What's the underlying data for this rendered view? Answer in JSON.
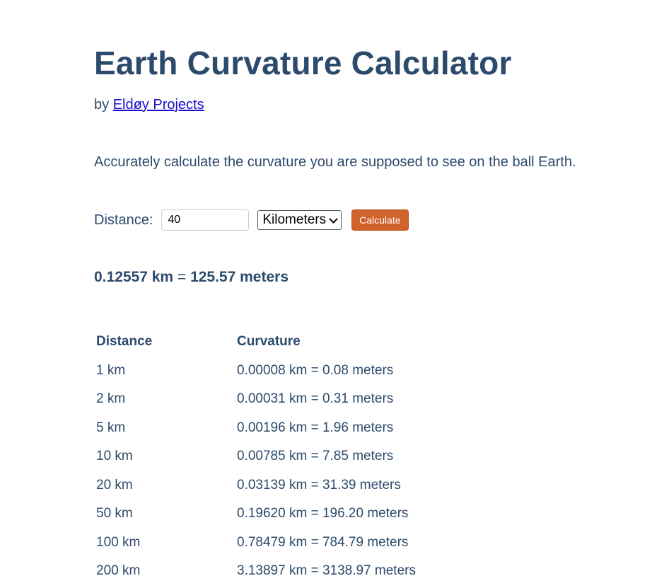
{
  "header": {
    "title": "Earth Curvature Calculator",
    "by_prefix": "by",
    "author_link": "Eldøy Projects"
  },
  "intro": "Accurately calculate the curvature you are supposed to see on the ball Earth.",
  "form": {
    "distance_label": "Distance:",
    "distance_value": "40",
    "unit_selected": "Kilometers",
    "calculate_label": "Calculate"
  },
  "result": {
    "km": "0.12557 km",
    "equals": "=",
    "meters": "125.57 meters"
  },
  "table": {
    "headers": [
      "Distance",
      "Curvature"
    ],
    "rows": [
      [
        "1 km",
        "0.00008 km = 0.08 meters"
      ],
      [
        "2 km",
        "0.00031 km = 0.31 meters"
      ],
      [
        "5 km",
        "0.00196 km = 1.96 meters"
      ],
      [
        "10 km",
        "0.00785 km = 7.85 meters"
      ],
      [
        "20 km",
        "0.03139 km = 31.39 meters"
      ],
      [
        "50 km",
        "0.19620 km = 196.20 meters"
      ],
      [
        "100 km",
        "0.78479 km = 784.79 meters"
      ],
      [
        "200 km",
        "3.13897 km = 3138.97 meters"
      ]
    ]
  },
  "colors": {
    "text": "#2c4a6b",
    "link": "#1a0dcc",
    "button": "#d0622c"
  }
}
